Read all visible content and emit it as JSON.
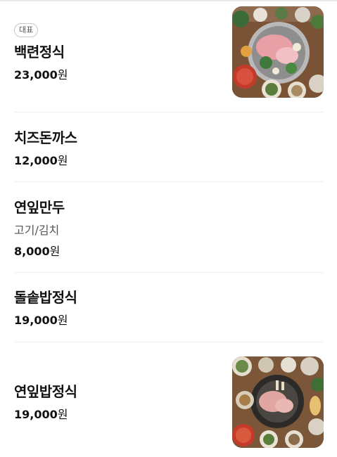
{
  "menu": {
    "items": [
      {
        "badge": "대표",
        "name": "백련정식",
        "price_value": "23,000",
        "price_unit": "원",
        "image": "food-photo-pork-hotpot"
      },
      {
        "name": "치즈돈까스",
        "price_value": "12,000",
        "price_unit": "원"
      },
      {
        "name": "연잎만두",
        "description": "고기/김치",
        "price_value": "8,000",
        "price_unit": "원"
      },
      {
        "name": "돌솥밥정식",
        "price_value": "19,000",
        "price_unit": "원"
      },
      {
        "name": "연잎밥정식",
        "price_value": "19,000",
        "price_unit": "원",
        "image": "food-photo-meat-pot"
      }
    ]
  }
}
